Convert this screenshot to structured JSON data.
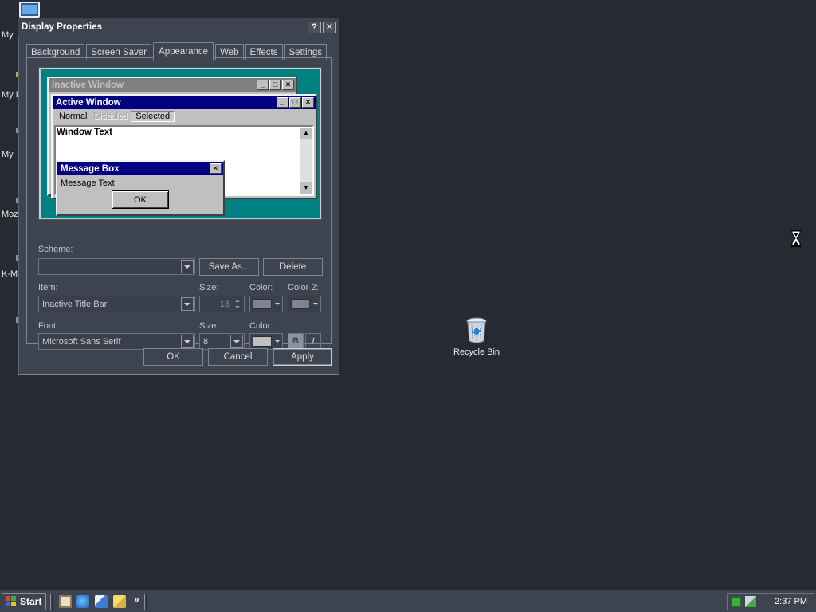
{
  "desktop": {
    "left_labels": [
      "My",
      "My D",
      "My",
      "Moz",
      "K-M"
    ],
    "recycle_bin_label": "Recycle Bin"
  },
  "dialog": {
    "title": "Display Properties",
    "help_btn": "?",
    "close_btn": "✕",
    "tabs": [
      "Background",
      "Screen Saver",
      "Appearance",
      "Web",
      "Effects",
      "Settings"
    ],
    "active_tab": "Appearance",
    "preview": {
      "inactive_title": "Inactive Window",
      "active_title": "Active Window",
      "menu_normal": "Normal",
      "menu_disabled": "Disabled",
      "menu_selected": "Selected",
      "window_text": "Window Text",
      "msgbox_title": "Message Box",
      "msgbox_text": "Message Text",
      "msgbox_ok": "OK"
    },
    "scheme": {
      "label": "Scheme:",
      "value": "",
      "save_as": "Save As...",
      "delete": "Delete"
    },
    "item": {
      "label": "Item:",
      "value": "Inactive Title Bar"
    },
    "item_size": {
      "label": "Size:",
      "value": "18"
    },
    "item_color": {
      "label": "Color:",
      "swatch": "#7e848c"
    },
    "item_color2": {
      "label": "Color 2:",
      "swatch": "#7e848c"
    },
    "font": {
      "label": "Font:",
      "value": "Microsoft Sans Serif"
    },
    "font_size": {
      "label": "Size:",
      "value": "8"
    },
    "font_color": {
      "label": "Color:",
      "swatch": "#c0c0c0"
    },
    "bold_label": "B",
    "italic_label": "I",
    "buttons": {
      "ok": "OK",
      "cancel": "Cancel",
      "apply": "Apply"
    }
  },
  "taskbar": {
    "start_label": "Start",
    "chevron": "»",
    "clock": "2:37 PM"
  },
  "colors": {
    "desktop_bg": "#262b33",
    "dialog_bg": "#3d4450",
    "preview_bg": "#008080",
    "active_title": "#000080",
    "inactive_title": "#808080"
  }
}
